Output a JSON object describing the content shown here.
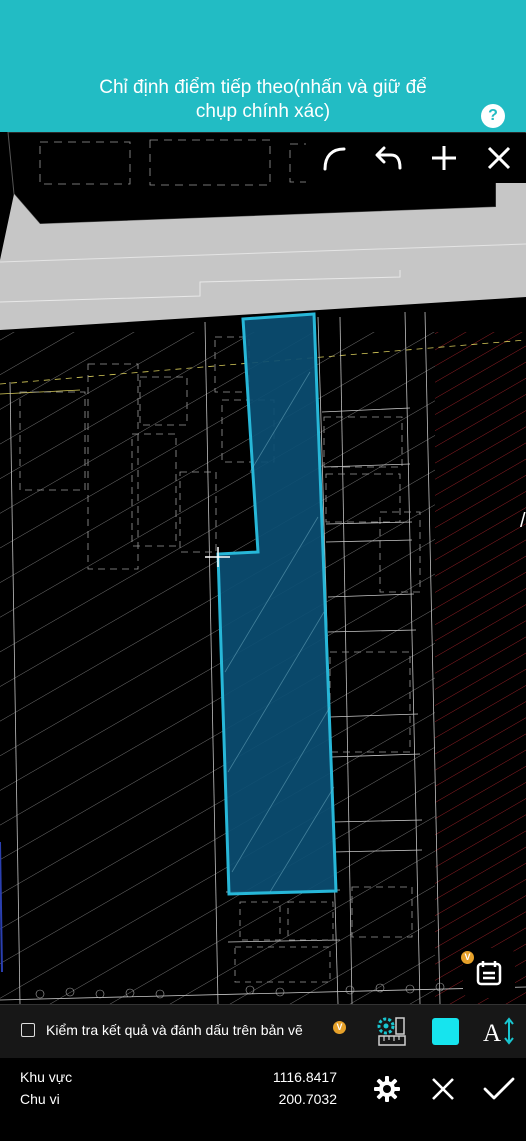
{
  "header": {
    "title_line1": "Chỉ định điểm tiếp theo(nhấn và giữ để",
    "title_line2": "chụp chính xác)",
    "help_icon": "?"
  },
  "toolbar": {
    "items": [
      {
        "icon": "arc-icon"
      },
      {
        "icon": "undo-icon"
      },
      {
        "icon": "plus-icon"
      },
      {
        "icon": "close-icon"
      }
    ]
  },
  "calendar": {
    "icon": "calendar-icon",
    "badge": "V"
  },
  "check_bar": {
    "label": "Kiểm tra kết quả và đánh dấu trên bản vẽ",
    "badge": "V",
    "checked": false,
    "swatch_color": "#16e4ee"
  },
  "stats": {
    "area_label": "Khu vực",
    "area_value": "1116.8417",
    "perimeter_label": "Chu vi",
    "perimeter_value": "200.7032"
  },
  "colors": {
    "header": "#22bcc4",
    "polygon_fill": "#0b4e72",
    "polygon_stroke": "#27b7d8"
  }
}
